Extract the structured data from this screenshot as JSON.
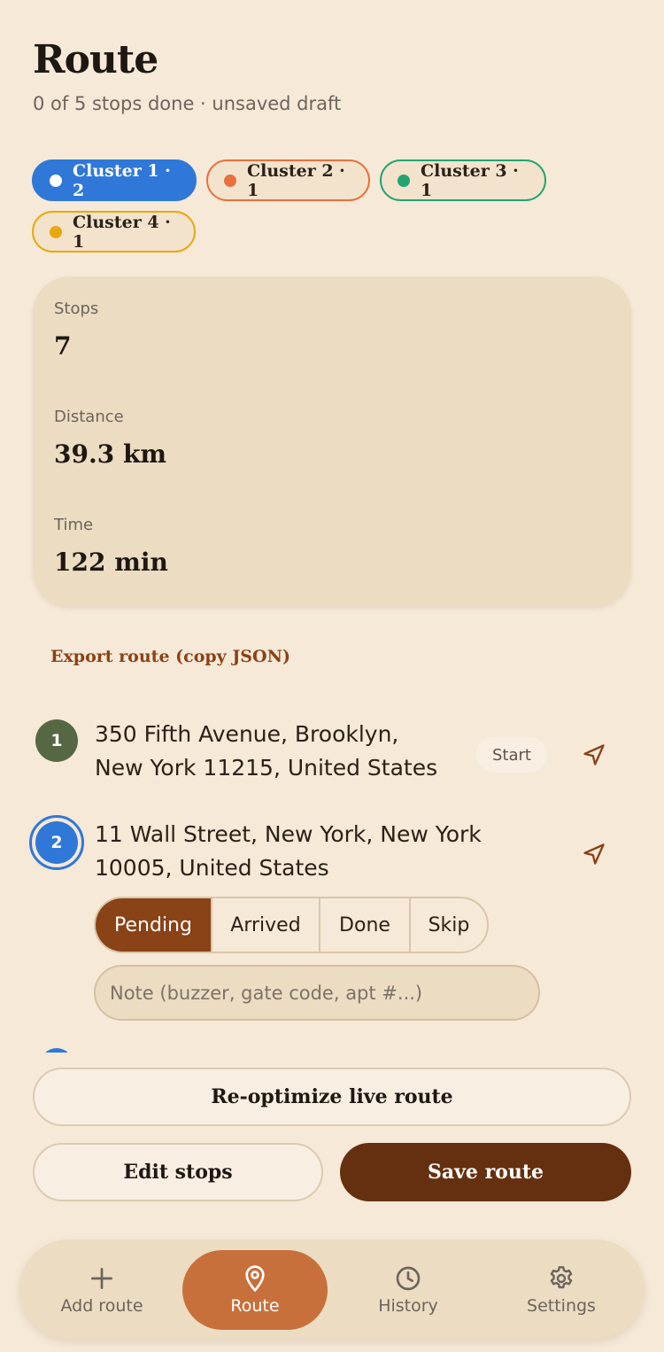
{
  "header": {
    "title": "Route",
    "subtitle": "0 of 5 stops done · unsaved draft"
  },
  "clusters": [
    {
      "label": "Cluster 1 · 2",
      "color": "#2f78d8",
      "active": true
    },
    {
      "label": "Cluster 2 · 1",
      "color": "#e8703e",
      "active": false
    },
    {
      "label": "Cluster 3 · 1",
      "color": "#22a472",
      "active": false
    },
    {
      "label": "Cluster 4 · 1",
      "color": "#e8a70c",
      "active": false
    }
  ],
  "stats": {
    "stops_label": "Stops",
    "stops_value": "7",
    "distance_label": "Distance",
    "distance_value": "39.3 km",
    "time_label": "Time",
    "time_value": "122 min"
  },
  "export_label": "Export route (copy JSON)",
  "stops": [
    {
      "num": "1",
      "line1": "350 Fifth Avenue, Brooklyn,",
      "line2": "New York 11215, United States",
      "badge": "Start",
      "color": "#566843"
    },
    {
      "num": "2",
      "line1": "11 Wall Street, New York, New York",
      "line2": "10005, United States",
      "color": "#2f78d8"
    }
  ],
  "status_options": [
    "Pending",
    "Arrived",
    "Done",
    "Skip"
  ],
  "status_selected": "Pending",
  "note": {
    "placeholder": "Note (buzzer, gate code, apt #...)",
    "value": ""
  },
  "actions": {
    "reoptimize": "Re-optimize live route",
    "edit": "Edit stops",
    "save": "Save route"
  },
  "tabs": [
    {
      "label": "Add route",
      "icon": "plus-icon"
    },
    {
      "label": "Route",
      "icon": "map-pin-icon",
      "active": true
    },
    {
      "label": "History",
      "icon": "clock-icon"
    },
    {
      "label": "Settings",
      "icon": "gear-icon"
    }
  ]
}
